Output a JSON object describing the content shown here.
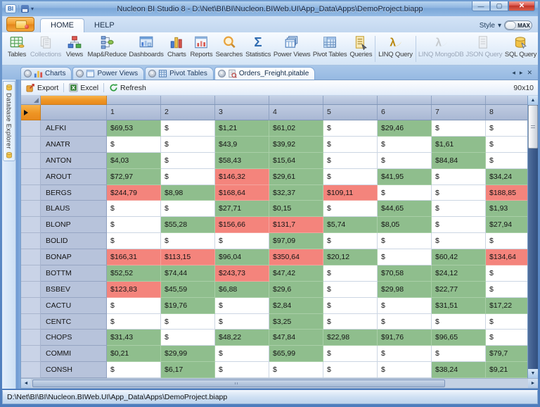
{
  "window": {
    "title": "Nucleon BI Studio 8 - D:\\Net\\BI\\BI\\Nucleon.BIWeb.UI\\App_Data\\Apps\\DemoProject.biapp"
  },
  "ribbon": {
    "tabs": [
      {
        "label": "HOME"
      },
      {
        "label": "HELP"
      }
    ],
    "style_label": "Style",
    "style_caret": "▾",
    "max_label": "MAX",
    "items": [
      {
        "label": "Tables",
        "icon": "tables-icon",
        "enabled": true
      },
      {
        "label": "Collections",
        "icon": "collections-icon",
        "enabled": false
      },
      {
        "label": "Views",
        "icon": "views-icon",
        "enabled": true
      },
      {
        "label": "Map&Reduce",
        "icon": "map-reduce-icon",
        "enabled": true
      },
      {
        "label": "Dashboards",
        "icon": "dashboards-icon",
        "enabled": true
      },
      {
        "label": "Charts",
        "icon": "charts-icon",
        "enabled": true
      },
      {
        "label": "Reports",
        "icon": "reports-icon",
        "enabled": true
      },
      {
        "label": "Searches",
        "icon": "searches-icon",
        "enabled": true
      },
      {
        "label": "Statistics",
        "icon": "statistics-icon",
        "enabled": true
      },
      {
        "label": "Power Views",
        "icon": "power-views-icon",
        "enabled": true
      },
      {
        "label": "Pivot Tables",
        "icon": "pivot-tables-icon",
        "enabled": true
      },
      {
        "label": "Queries",
        "icon": "queries-icon",
        "enabled": true
      },
      {
        "label": "LINQ Query",
        "icon": "linq-query-icon",
        "enabled": true
      },
      {
        "label": "LINQ MongoDB",
        "icon": "linq-mongodb-icon",
        "enabled": false
      },
      {
        "label": "JSON Query",
        "icon": "json-query-icon",
        "enabled": false
      },
      {
        "label": "SQL Query",
        "icon": "sql-query-icon",
        "enabled": true
      }
    ]
  },
  "doc_tabs": [
    {
      "label": "Charts",
      "icon": "chart-tab-icon",
      "active": false
    },
    {
      "label": "Power Views",
      "icon": "power-views-tab-icon",
      "active": false
    },
    {
      "label": "Pivot Tables",
      "icon": "pivot-tab-icon",
      "active": false
    },
    {
      "label": "Orders_Freight.pitable",
      "icon": "pivot-file-icon",
      "active": true
    }
  ],
  "tab_controls": {
    "prev": "◂",
    "next": "▸",
    "close": "✕"
  },
  "toolbar": {
    "export_label": "Export",
    "excel_label": "Excel",
    "refresh_label": "Refresh",
    "dims": "90x10"
  },
  "sidebar": {
    "label": "Database Explorer"
  },
  "grid": {
    "columns": [
      "1",
      "2",
      "3",
      "4",
      "5",
      "6",
      "7",
      "8"
    ],
    "colors": {
      "green": "#8fbe8d",
      "red": "#f4847c",
      "white": "#ffffff",
      "orange": "#ee9524"
    },
    "rows": [
      {
        "label": "ALFKI",
        "cells": [
          {
            "v": "$69,53",
            "c": "g"
          },
          {
            "v": "$",
            "c": "w"
          },
          {
            "v": "$1,21",
            "c": "g"
          },
          {
            "v": "$61,02",
            "c": "g"
          },
          {
            "v": "$",
            "c": "w"
          },
          {
            "v": "$29,46",
            "c": "g"
          },
          {
            "v": "$",
            "c": "w"
          },
          {
            "v": "$",
            "c": "w"
          }
        ]
      },
      {
        "label": "ANATR",
        "cells": [
          {
            "v": "$",
            "c": "w"
          },
          {
            "v": "$",
            "c": "w"
          },
          {
            "v": "$43,9",
            "c": "g"
          },
          {
            "v": "$39,92",
            "c": "g"
          },
          {
            "v": "$",
            "c": "w"
          },
          {
            "v": "$",
            "c": "w"
          },
          {
            "v": "$1,61",
            "c": "g"
          },
          {
            "v": "$",
            "c": "w"
          }
        ]
      },
      {
        "label": "ANTON",
        "cells": [
          {
            "v": "$4,03",
            "c": "g"
          },
          {
            "v": "$",
            "c": "w"
          },
          {
            "v": "$58,43",
            "c": "g"
          },
          {
            "v": "$15,64",
            "c": "g"
          },
          {
            "v": "$",
            "c": "w"
          },
          {
            "v": "$",
            "c": "w"
          },
          {
            "v": "$84,84",
            "c": "g"
          },
          {
            "v": "$",
            "c": "w"
          }
        ]
      },
      {
        "label": "AROUT",
        "cells": [
          {
            "v": "$72,97",
            "c": "g"
          },
          {
            "v": "$",
            "c": "w"
          },
          {
            "v": "$146,32",
            "c": "r"
          },
          {
            "v": "$29,61",
            "c": "g"
          },
          {
            "v": "$",
            "c": "w"
          },
          {
            "v": "$41,95",
            "c": "g"
          },
          {
            "v": "$",
            "c": "w"
          },
          {
            "v": "$34,24",
            "c": "g"
          }
        ]
      },
      {
        "label": "BERGS",
        "cells": [
          {
            "v": "$244,79",
            "c": "r"
          },
          {
            "v": "$8,98",
            "c": "g"
          },
          {
            "v": "$168,64",
            "c": "r"
          },
          {
            "v": "$32,37",
            "c": "g"
          },
          {
            "v": "$109,11",
            "c": "r"
          },
          {
            "v": "$",
            "c": "w"
          },
          {
            "v": "$",
            "c": "w"
          },
          {
            "v": "$188,85",
            "c": "r"
          }
        ]
      },
      {
        "label": "BLAUS",
        "cells": [
          {
            "v": "$",
            "c": "w"
          },
          {
            "v": "$",
            "c": "w"
          },
          {
            "v": "$27,71",
            "c": "g"
          },
          {
            "v": "$0,15",
            "c": "g"
          },
          {
            "v": "$",
            "c": "w"
          },
          {
            "v": "$44,65",
            "c": "g"
          },
          {
            "v": "$",
            "c": "w"
          },
          {
            "v": "$1,93",
            "c": "g"
          }
        ]
      },
      {
        "label": "BLONP",
        "cells": [
          {
            "v": "$",
            "c": "w"
          },
          {
            "v": "$55,28",
            "c": "g"
          },
          {
            "v": "$156,66",
            "c": "r"
          },
          {
            "v": "$131,7",
            "c": "r"
          },
          {
            "v": "$5,74",
            "c": "g"
          },
          {
            "v": "$8,05",
            "c": "g"
          },
          {
            "v": "$",
            "c": "w"
          },
          {
            "v": "$27,94",
            "c": "g"
          }
        ]
      },
      {
        "label": "BOLID",
        "cells": [
          {
            "v": "$",
            "c": "w"
          },
          {
            "v": "$",
            "c": "w"
          },
          {
            "v": "$",
            "c": "w"
          },
          {
            "v": "$97,09",
            "c": "g"
          },
          {
            "v": "$",
            "c": "w"
          },
          {
            "v": "$",
            "c": "w"
          },
          {
            "v": "$",
            "c": "w"
          },
          {
            "v": "$",
            "c": "w"
          }
        ]
      },
      {
        "label": "BONAP",
        "cells": [
          {
            "v": "$166,31",
            "c": "r"
          },
          {
            "v": "$113,15",
            "c": "r"
          },
          {
            "v": "$96,04",
            "c": "g"
          },
          {
            "v": "$350,64",
            "c": "r"
          },
          {
            "v": "$20,12",
            "c": "g"
          },
          {
            "v": "$",
            "c": "w"
          },
          {
            "v": "$60,42",
            "c": "g"
          },
          {
            "v": "$134,64",
            "c": "r"
          }
        ]
      },
      {
        "label": "BOTTM",
        "cells": [
          {
            "v": "$52,52",
            "c": "g"
          },
          {
            "v": "$74,44",
            "c": "g"
          },
          {
            "v": "$243,73",
            "c": "r"
          },
          {
            "v": "$47,42",
            "c": "g"
          },
          {
            "v": "$",
            "c": "w"
          },
          {
            "v": "$70,58",
            "c": "g"
          },
          {
            "v": "$24,12",
            "c": "g"
          },
          {
            "v": "$",
            "c": "w"
          }
        ]
      },
      {
        "label": "BSBEV",
        "cells": [
          {
            "v": "$123,83",
            "c": "r"
          },
          {
            "v": "$45,59",
            "c": "g"
          },
          {
            "v": "$6,88",
            "c": "g"
          },
          {
            "v": "$29,6",
            "c": "g"
          },
          {
            "v": "$",
            "c": "w"
          },
          {
            "v": "$29,98",
            "c": "g"
          },
          {
            "v": "$22,77",
            "c": "g"
          },
          {
            "v": "$",
            "c": "w"
          }
        ]
      },
      {
        "label": "CACTU",
        "cells": [
          {
            "v": "$",
            "c": "w"
          },
          {
            "v": "$19,76",
            "c": "g"
          },
          {
            "v": "$",
            "c": "w"
          },
          {
            "v": "$2,84",
            "c": "g"
          },
          {
            "v": "$",
            "c": "w"
          },
          {
            "v": "$",
            "c": "w"
          },
          {
            "v": "$31,51",
            "c": "g"
          },
          {
            "v": "$17,22",
            "c": "g"
          }
        ]
      },
      {
        "label": "CENTC",
        "cells": [
          {
            "v": "$",
            "c": "w"
          },
          {
            "v": "$",
            "c": "w"
          },
          {
            "v": "$",
            "c": "w"
          },
          {
            "v": "$3,25",
            "c": "g"
          },
          {
            "v": "$",
            "c": "w"
          },
          {
            "v": "$",
            "c": "w"
          },
          {
            "v": "$",
            "c": "w"
          },
          {
            "v": "$",
            "c": "w"
          }
        ]
      },
      {
        "label": "CHOPS",
        "cells": [
          {
            "v": "$31,43",
            "c": "g"
          },
          {
            "v": "$",
            "c": "w"
          },
          {
            "v": "$48,22",
            "c": "g"
          },
          {
            "v": "$47,84",
            "c": "g"
          },
          {
            "v": "$22,98",
            "c": "g"
          },
          {
            "v": "$91,76",
            "c": "g"
          },
          {
            "v": "$96,65",
            "c": "g"
          },
          {
            "v": "$",
            "c": "w"
          }
        ]
      },
      {
        "label": "COMMI",
        "cells": [
          {
            "v": "$0,21",
            "c": "g"
          },
          {
            "v": "$29,99",
            "c": "g"
          },
          {
            "v": "$",
            "c": "w"
          },
          {
            "v": "$65,99",
            "c": "g"
          },
          {
            "v": "$",
            "c": "w"
          },
          {
            "v": "$",
            "c": "w"
          },
          {
            "v": "$",
            "c": "w"
          },
          {
            "v": "$79,7",
            "c": "g"
          }
        ]
      },
      {
        "label": "CONSH",
        "cells": [
          {
            "v": "$",
            "c": "w"
          },
          {
            "v": "$6,17",
            "c": "g"
          },
          {
            "v": "$",
            "c": "w"
          },
          {
            "v": "$",
            "c": "w"
          },
          {
            "v": "$",
            "c": "w"
          },
          {
            "v": "$",
            "c": "w"
          },
          {
            "v": "$38,24",
            "c": "g"
          },
          {
            "v": "$9,21",
            "c": "g"
          }
        ]
      }
    ]
  },
  "status": {
    "text": "D:\\Net\\BI\\BI\\Nucleon.BIWeb.UI\\App_Data\\Apps\\DemoProject.biapp"
  }
}
